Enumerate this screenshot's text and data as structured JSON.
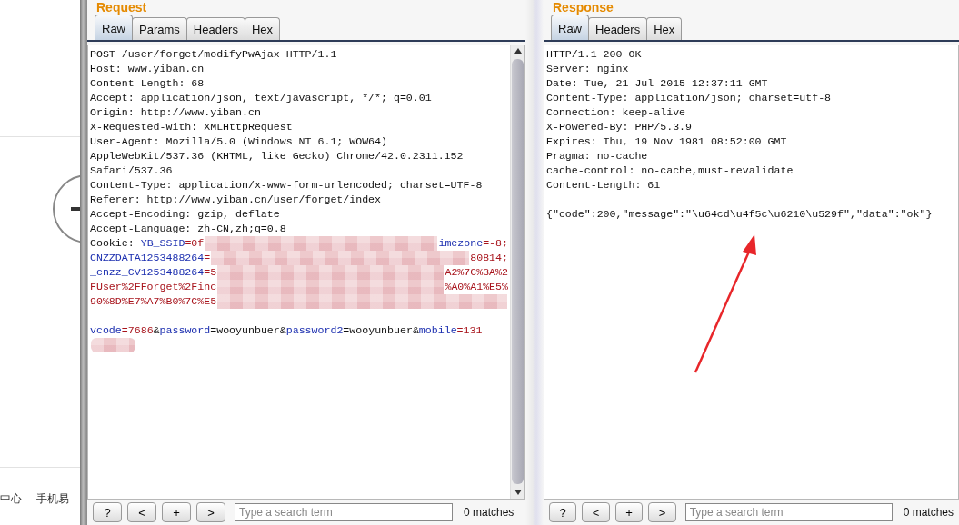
{
  "background_page": {
    "links": [
      "中心",
      "手机易"
    ]
  },
  "request": {
    "title": "Request",
    "tabs": [
      {
        "label": "Raw",
        "selected": true
      },
      {
        "label": "Params",
        "selected": false
      },
      {
        "label": "Headers",
        "selected": false
      },
      {
        "label": "Hex",
        "selected": false
      }
    ],
    "lines": [
      [
        {
          "kind": "plain",
          "text": "POST /user/forget/modifyPwAjax HTTP/1.1"
        }
      ],
      [
        {
          "kind": "plain",
          "text": "Host: www.yiban.cn"
        }
      ],
      [
        {
          "kind": "plain",
          "text": "Content-Length: 68"
        }
      ],
      [
        {
          "kind": "plain",
          "text": "Accept: application/json, text/javascript, */*; q=0.01"
        }
      ],
      [
        {
          "kind": "plain",
          "text": "Origin: http://www.yiban.cn"
        }
      ],
      [
        {
          "kind": "plain",
          "text": "X-Requested-With: XMLHttpRequest"
        }
      ],
      [
        {
          "kind": "plain",
          "text": "User-Agent: Mozilla/5.0 (Windows NT 6.1; WOW64)"
        }
      ],
      [
        {
          "kind": "plain",
          "text": "AppleWebKit/537.36 (KHTML, like Gecko) Chrome/42.0.2311.152"
        }
      ],
      [
        {
          "kind": "plain",
          "text": "Safari/537.36"
        }
      ],
      [
        {
          "kind": "plain",
          "text": "Content-Type: application/x-www-form-urlencoded; charset=UTF-8"
        }
      ],
      [
        {
          "kind": "plain",
          "text": "Referer: http://www.yiban.cn/user/forget/index"
        }
      ],
      [
        {
          "kind": "plain",
          "text": "Accept-Encoding: gzip, deflate"
        }
      ],
      [
        {
          "kind": "plain",
          "text": "Accept-Language: zh-CN,zh;q=0.8"
        }
      ],
      [
        {
          "kind": "plain",
          "text": "Cookie: "
        },
        {
          "kind": "key",
          "text": "YB_SSID"
        },
        {
          "kind": "value",
          "text": "=0f"
        },
        {
          "kind": "redacted"
        },
        {
          "kind": "key",
          "text": "imezone"
        },
        {
          "kind": "value",
          "text": "=-8;"
        }
      ],
      [
        {
          "kind": "key",
          "text": "CNZZDATA1253488264"
        },
        {
          "kind": "value",
          "text": "="
        },
        {
          "kind": "redacted"
        },
        {
          "kind": "value",
          "text": "80814;"
        }
      ],
      [
        {
          "kind": "key",
          "text": "_cnzz_CV1253488264"
        },
        {
          "kind": "value",
          "text": "=5"
        },
        {
          "kind": "redacted"
        },
        {
          "kind": "value",
          "text": "A2%7C%3A%2"
        }
      ],
      [
        {
          "kind": "value",
          "text": "FUser%2FForget%2Finc"
        },
        {
          "kind": "redacted"
        },
        {
          "kind": "value",
          "text": "%A0%A1%E5%"
        }
      ],
      [
        {
          "kind": "value",
          "text": "90%8D%E7%A7%B0%7C%E5"
        },
        {
          "kind": "redacted"
        }
      ],
      [
        {
          "kind": "key",
          "blank_before": true,
          "text": "vcode"
        },
        {
          "kind": "value",
          "text": "=7686"
        },
        {
          "kind": "plain",
          "text": "&"
        },
        {
          "kind": "key",
          "text": "password"
        },
        {
          "kind": "plain",
          "text": "=wooyunbuer&"
        },
        {
          "kind": "key",
          "text": "password2"
        },
        {
          "kind": "plain",
          "text": "=wooyunbuer&"
        },
        {
          "kind": "key",
          "text": "mobile"
        },
        {
          "kind": "value",
          "text": "=131"
        }
      ],
      [
        {
          "kind": "redacted"
        }
      ]
    ],
    "toolbar": {
      "buttons": [
        "?",
        "<",
        "+",
        ">"
      ],
      "search_placeholder": "Type a search term",
      "matches": "0 matches"
    }
  },
  "response": {
    "title": "Response",
    "tabs": [
      {
        "label": "Raw",
        "selected": true
      },
      {
        "label": "Headers",
        "selected": false
      },
      {
        "label": "Hex",
        "selected": false
      }
    ],
    "lines": [
      [
        {
          "kind": "plain",
          "text": "HTTP/1.1 200 OK"
        }
      ],
      [
        {
          "kind": "plain",
          "text": "Server: nginx"
        }
      ],
      [
        {
          "kind": "plain",
          "text": "Date: Tue, 21 Jul 2015 12:37:11 GMT"
        }
      ],
      [
        {
          "kind": "plain",
          "text": "Content-Type: application/json; charset=utf-8"
        }
      ],
      [
        {
          "kind": "plain",
          "text": "Connection: keep-alive"
        }
      ],
      [
        {
          "kind": "plain",
          "text": "X-Powered-By: PHP/5.3.9"
        }
      ],
      [
        {
          "kind": "plain",
          "text": "Expires: Thu, 19 Nov 1981 08:52:00 GMT"
        }
      ],
      [
        {
          "kind": "plain",
          "text": "Pragma: no-cache"
        }
      ],
      [
        {
          "kind": "plain",
          "text": "cache-control: no-cache,must-revalidate"
        }
      ],
      [
        {
          "kind": "plain",
          "text": "Content-Length: 61"
        }
      ],
      [
        {
          "kind": "plain",
          "blank_before": true,
          "text": "{\"code\":200,\"message\":\"\\u64cd\\u4f5c\\u6210\\u529f\",\"data\":\"ok\"}"
        }
      ]
    ],
    "toolbar": {
      "buttons": [
        "?",
        "<",
        "+",
        ">"
      ],
      "search_placeholder": "Type a search term",
      "matches": "0 matches"
    }
  }
}
